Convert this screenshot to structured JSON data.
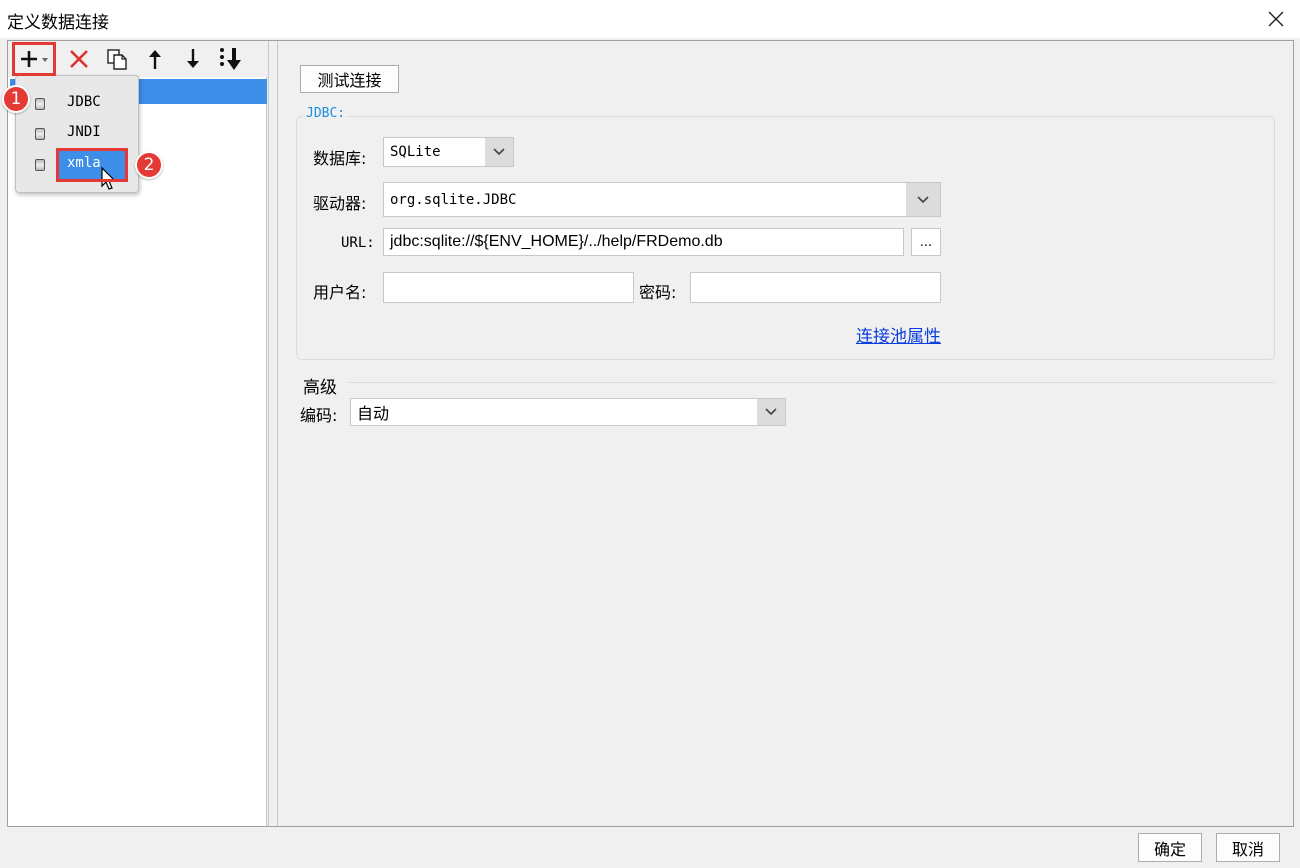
{
  "window": {
    "title": "定义数据连接",
    "close_icon": "close-icon"
  },
  "toolbar": {
    "add_icon": "plus-icon",
    "delete_icon": "delete-icon",
    "copy_icon": "copy-icon",
    "up_icon": "arrow-up-icon",
    "down_icon": "arrow-down-icon",
    "sort_icon": "sort-icon"
  },
  "add_menu": {
    "items": [
      {
        "label": "JDBC"
      },
      {
        "label": "JNDI"
      },
      {
        "label": "xmla"
      }
    ]
  },
  "annotations": {
    "step1": "1",
    "step2": "2"
  },
  "right": {
    "test_button": "测试连接",
    "jdbc_group_title": "JDBC:",
    "database_label": "数据库:",
    "database_value": "SQLite",
    "driver_label": "驱动器:",
    "driver_value": "org.sqlite.JDBC",
    "url_label": "URL:",
    "url_value": "jdbc:sqlite://${ENV_HOME}/../help/FRDemo.db",
    "url_browse": "...",
    "username_label": "用户名:",
    "username_value": "",
    "password_label": "密码:",
    "password_value": "",
    "pool_link": "连接池属性",
    "advanced_title": "高级",
    "encoding_label": "编码:",
    "encoding_value": "自动"
  },
  "footer": {
    "ok": "确定",
    "cancel": "取消"
  },
  "colors": {
    "selection": "#3d8ee8",
    "annotation_red": "#e53935",
    "link": "#0b3ee0",
    "group_title": "#1a8fe0"
  }
}
